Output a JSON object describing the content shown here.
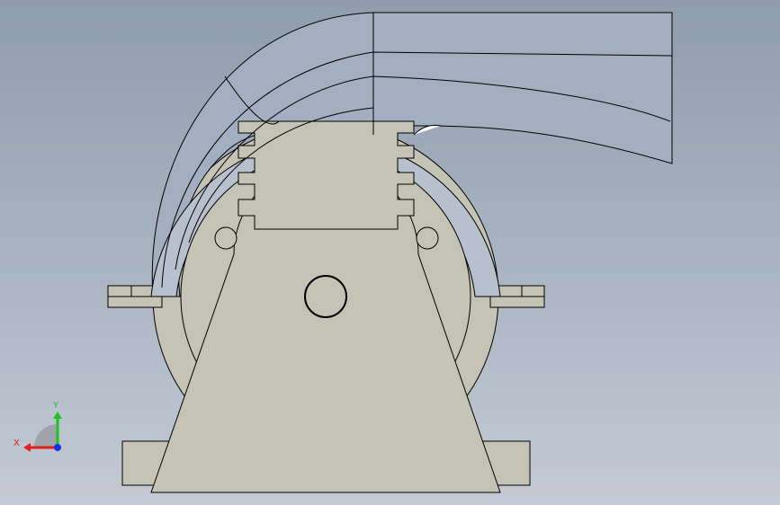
{
  "scene": {
    "background_top": "#8f9cad",
    "background_bottom": "#c3cad4",
    "part_fill": "#c4c3b5",
    "duct_fill": "#a3afc0",
    "edge_color": "#000000"
  },
  "triad": {
    "x_label": "X",
    "y_label": "Y",
    "x_color": "#e02020",
    "y_color": "#20c020",
    "z_color": "#2030e0"
  }
}
